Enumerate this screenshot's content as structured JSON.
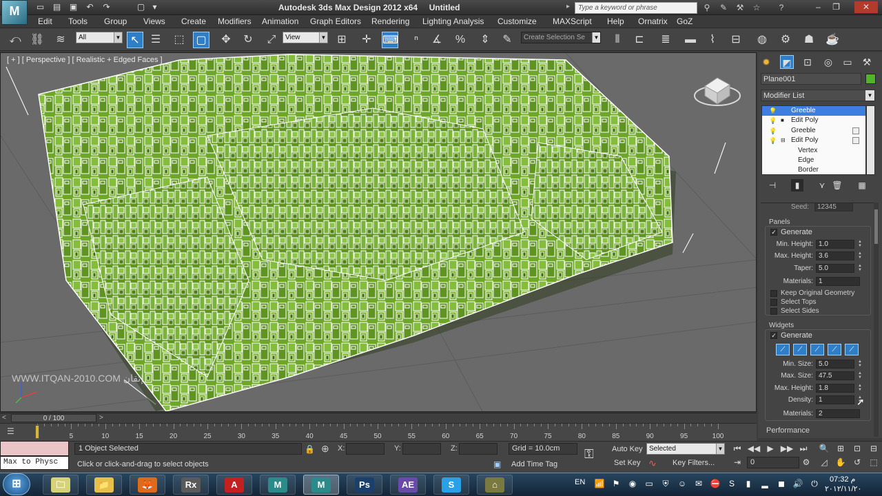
{
  "window": {
    "app_title": "Autodesk 3ds Max Design 2012 x64",
    "doc_title": "Untitled",
    "search_placeholder": "Type a keyword or phrase",
    "logo_text": "M"
  },
  "menus": [
    "Edit",
    "Tools",
    "Group",
    "Views",
    "Create",
    "Modifiers",
    "Animation",
    "Graph Editors",
    "Rendering",
    "Lighting Analysis",
    "Customize",
    "MAXScript",
    "Help",
    "Ornatrix",
    "GoZ"
  ],
  "toolbar": {
    "selection_filter": "All",
    "ref_coord": "View",
    "named_selection_placeholder": "Create Selection Se"
  },
  "viewport": {
    "label": "[ + ] [ Perspective ] [ Realistic + Edged Faces ]",
    "watermark": "WWW.ITQAN-2010.COM",
    "watermark_arabic": "إتقان",
    "mesh_color": "#6ea62a"
  },
  "command_panel": {
    "object_name": "Plane001",
    "object_color": "#50b428",
    "modifier_list_label": "Modifier List",
    "stack": [
      {
        "label": "Greeble",
        "selected": true,
        "indent": 0,
        "has_box": false,
        "has_square": false
      },
      {
        "label": "Edit Poly",
        "selected": false,
        "indent": 0,
        "has_box": true,
        "has_square": false
      },
      {
        "label": "Greeble",
        "selected": false,
        "indent": 0,
        "has_box": false,
        "has_square": true
      },
      {
        "label": "Edit Poly",
        "selected": false,
        "indent": 0,
        "has_box": true,
        "has_square": true
      },
      {
        "label": "Vertex",
        "selected": false,
        "indent": 1,
        "has_box": false,
        "has_square": false
      },
      {
        "label": "Edge",
        "selected": false,
        "indent": 1,
        "has_box": false,
        "has_square": false
      },
      {
        "label": "Border",
        "selected": false,
        "indent": 1,
        "has_box": false,
        "has_square": false
      }
    ],
    "seed_label": "Seed:",
    "seed_value": "12345",
    "panels": {
      "title": "Panels",
      "generate": "Generate",
      "min_height_label": "Min. Height:",
      "min_height": "1.0",
      "max_height_label": "Max. Height:",
      "max_height": "3.6",
      "taper_label": "Taper:",
      "taper": "5.0",
      "materials_label": "Materials:",
      "materials": "1",
      "keep_original": "Keep Original Geometry",
      "select_tops": "Select Tops",
      "select_sides": "Select Sides"
    },
    "widgets": {
      "title": "Widgets",
      "generate": "Generate",
      "min_size_label": "Min. Size:",
      "min_size": "5.0",
      "max_size_label": "Max. Size:",
      "max_size": "47.5",
      "max_height_label": "Max. Height:",
      "max_height": "1.8",
      "density_label": "Density:",
      "density": "1",
      "materials_label": "Materials:",
      "materials": "2"
    },
    "performance_label": "Performance"
  },
  "timeline": {
    "frame_display": "0 / 100",
    "ticks": [
      "5",
      "10",
      "15",
      "20",
      "25",
      "30",
      "35",
      "40",
      "45",
      "50",
      "55",
      "60",
      "65",
      "70",
      "75",
      "80",
      "85",
      "90",
      "95",
      "100"
    ]
  },
  "status": {
    "maxscript_text": "Max to Physc",
    "selection": "1 Object Selected",
    "prompt": "Click or click-and-drag to select objects",
    "x_label": "X:",
    "y_label": "Y:",
    "z_label": "Z:",
    "grid": "Grid = 10.0cm",
    "add_time_tag": "Add Time Tag",
    "auto_key": "Auto Key",
    "set_key": "Set Key",
    "key_mode": "Selected",
    "key_filters": "Key Filters...",
    "current_frame": "0"
  },
  "taskbar": {
    "lang": "EN",
    "time": "07:32 م",
    "date": "٢٠١٢/١١/٢٠",
    "apps": [
      {
        "name": "files-app",
        "glyph": "🗀"
      },
      {
        "name": "explorer",
        "glyph": "📁"
      },
      {
        "name": "firefox",
        "glyph": "🦊"
      },
      {
        "name": "rx",
        "glyph": "Rx"
      },
      {
        "name": "acrobat",
        "glyph": "A"
      },
      {
        "name": "max3d-a",
        "glyph": "M"
      },
      {
        "name": "max3d-b",
        "glyph": "M"
      },
      {
        "name": "photoshop",
        "glyph": "Ps"
      },
      {
        "name": "after-effects",
        "glyph": "AE"
      },
      {
        "name": "skype",
        "glyph": "S"
      },
      {
        "name": "misc-app",
        "glyph": "⌂"
      }
    ]
  }
}
